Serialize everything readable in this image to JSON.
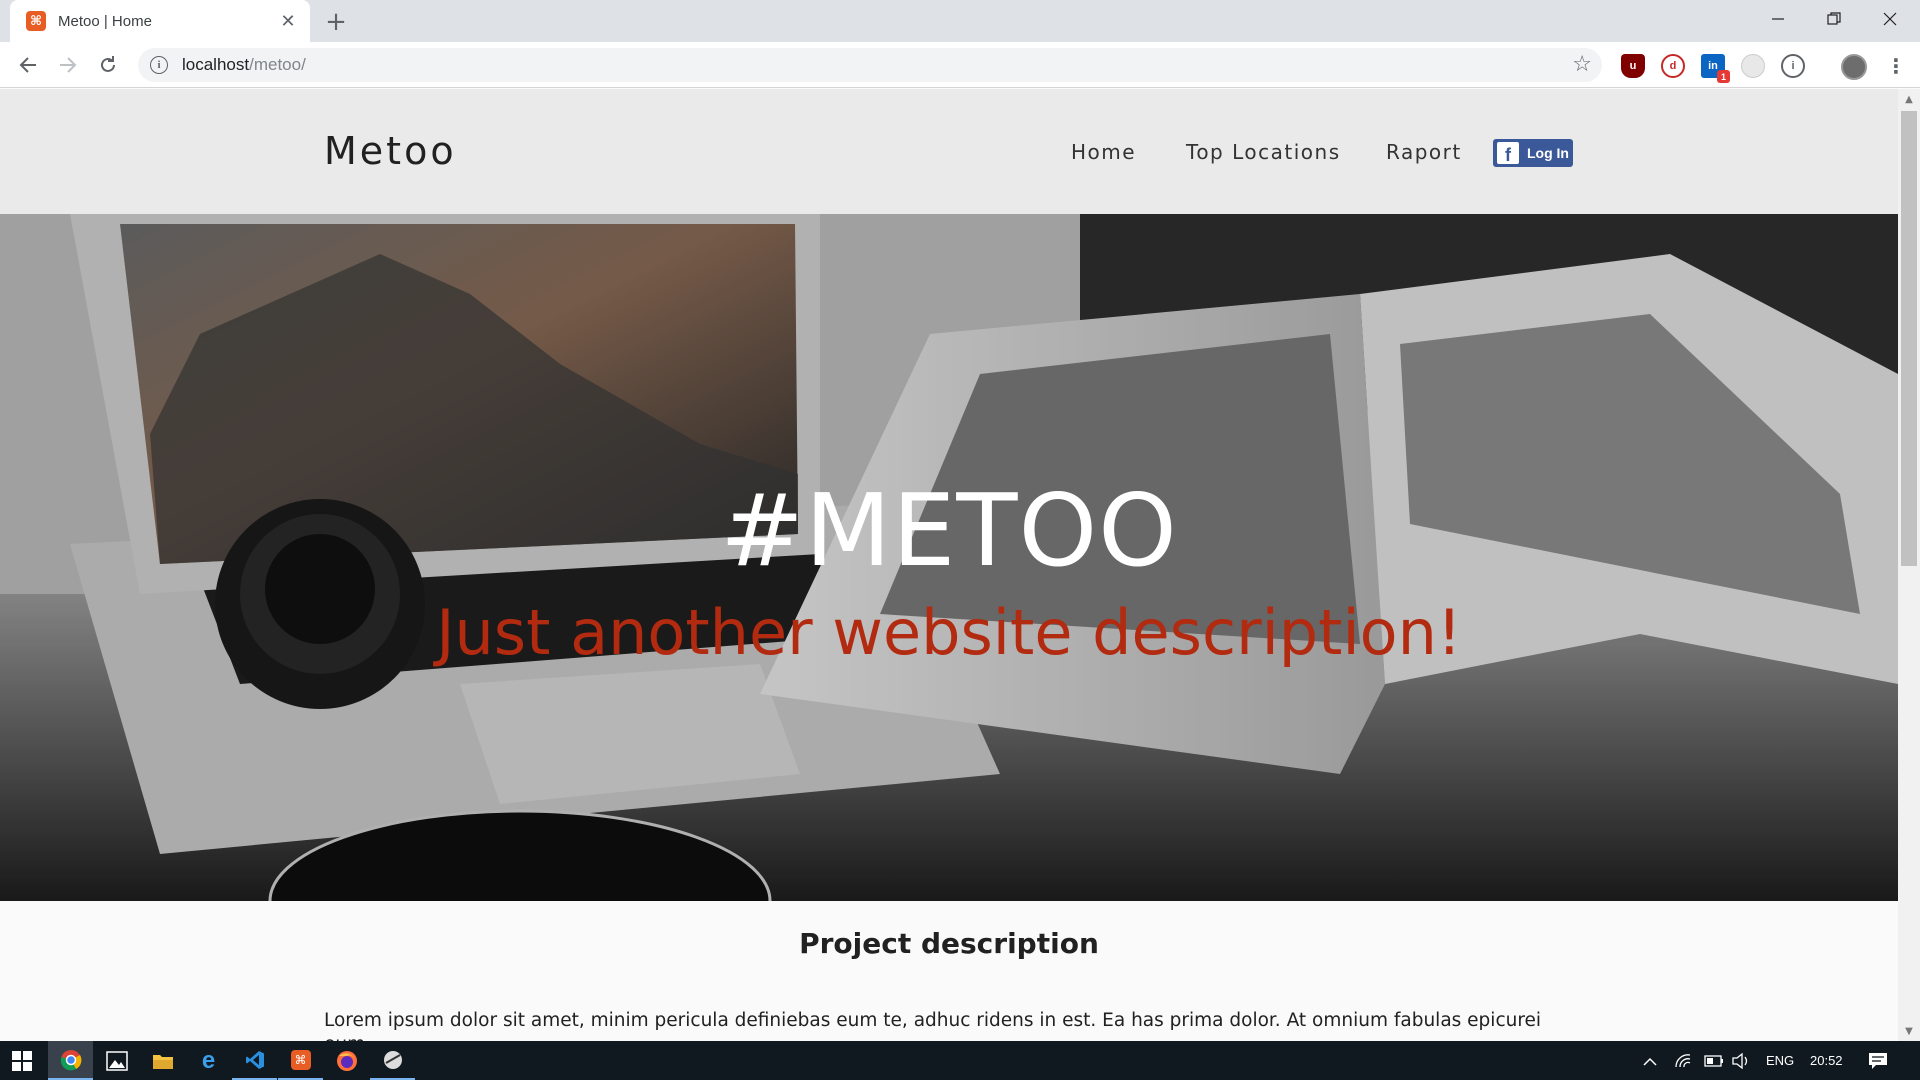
{
  "browser": {
    "tab_title": "Metoo | Home",
    "tab_favicon": "xampp-icon",
    "url_host": "localhost",
    "url_path": "/metoo/",
    "extension_badge": "1"
  },
  "site": {
    "brand": "Metoo",
    "nav": [
      "Home",
      "Top Locations",
      "Raport"
    ],
    "fb_login_label": "Log In",
    "hero_title": "#METOO",
    "hero_subtitle": "Just another website description!",
    "section_title": "Project description",
    "description": "Lorem ipsum dolor sit amet, minim pericula definiebas eum te, adhuc ridens in est. Ea has prima dolor. At omnium fabulas epicurei eum."
  },
  "taskbar": {
    "lang": "ENG",
    "time": "20:52"
  },
  "colors": {
    "accent_red": "#b22a0f",
    "facebook_blue": "#3b5998",
    "header_bg": "#eaeaea"
  }
}
